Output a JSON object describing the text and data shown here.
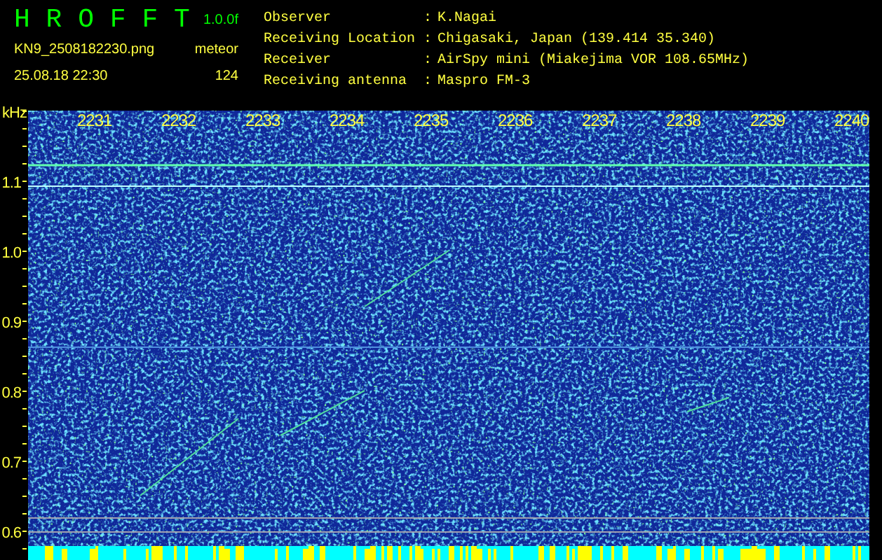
{
  "header": {
    "title": "H R O F F T",
    "version": "1.0.0f",
    "filename": "KN9_2508182230.png",
    "mode": "meteor",
    "datetime": "25.08.18 22:30",
    "count": "124"
  },
  "info": [
    {
      "label": "Observer",
      "value": "K.Nagai"
    },
    {
      "label": "Receiving Location",
      "value": "Chigasaki, Japan (139.414 35.340)"
    },
    {
      "label": "Receiver",
      "value": "AirSpy mini (Miakejima VOR 108.65MHz)"
    },
    {
      "label": "Receiving antenna",
      "value": "Maspro FM-3"
    }
  ],
  "separator": ":",
  "spectrogram": {
    "y_unit": "kHz",
    "y_labels": [
      "1.1",
      "1.0",
      "0.9",
      "0.8",
      "0.7",
      "0.6"
    ],
    "time_labels": [
      "2231",
      "2232",
      "2233",
      "2234",
      "2235",
      "2236",
      "2237",
      "2238",
      "2239",
      "2240"
    ]
  }
}
